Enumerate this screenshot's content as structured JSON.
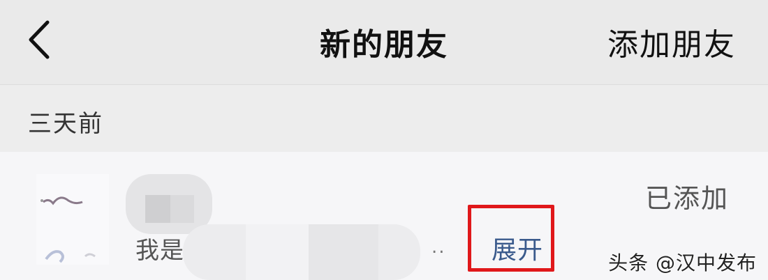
{
  "navbar": {
    "back_icon": "chevron-left-icon",
    "title": "新的朋友",
    "action_label": "添加朋友"
  },
  "section": {
    "label": "三天前"
  },
  "request": {
    "message_prefix": "我是",
    "ellipsis": "..",
    "expand_label": "展开",
    "status": "已添加",
    "highlight_color": "#e0181b",
    "link_color": "#3a5a8c"
  },
  "watermark": {
    "text": "头条 @汉中发布"
  }
}
